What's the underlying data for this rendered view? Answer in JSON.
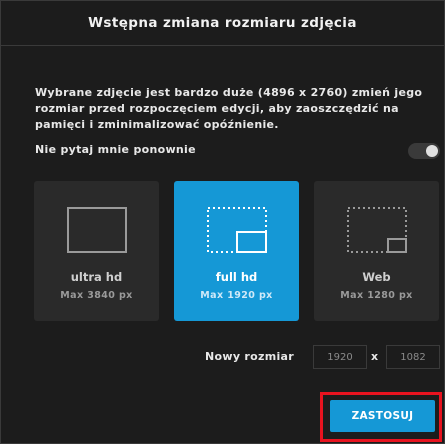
{
  "dialog": {
    "title": "Wstępna zmiana rozmiaru zdjęcia",
    "message": "Wybrane zdjęcie jest bardzo duże (4896 x 2760) zmień jego rozmiar przed rozpoczęciem edycji, aby zaoszczędzić na pamięci i zminimalizować opóźnienie.",
    "dont_ask_label": "Nie pytaj mnie ponownie",
    "dont_ask_enabled": false
  },
  "presets": [
    {
      "name": "ultra hd",
      "max": "Max 3840 px",
      "selected": false,
      "icon": "full-frame-icon"
    },
    {
      "name": "full hd",
      "max": "Max 1920 px",
      "selected": true,
      "icon": "dotted-frame-large-icon"
    },
    {
      "name": "Web",
      "max": "Max 1280 px",
      "selected": false,
      "icon": "dotted-frame-small-icon"
    }
  ],
  "new_size": {
    "label": "Nowy rozmiar",
    "width": "1920",
    "separator": "x",
    "height": "1082"
  },
  "apply_label": "ZASTOSUJ",
  "colors": {
    "accent": "#1598d6",
    "background": "#1c1c1c",
    "card": "#2a2a2a",
    "highlight_frame": "#e8131f"
  }
}
